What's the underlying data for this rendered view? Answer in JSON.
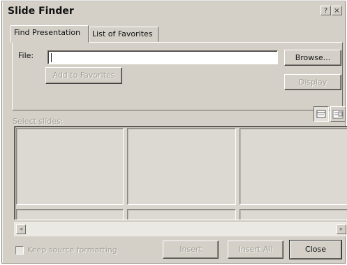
{
  "window": {
    "title": "Slide Finder",
    "help_glyph": "?",
    "close_glyph": "×"
  },
  "tabs": [
    {
      "label": "Find Presentation",
      "active": true
    },
    {
      "label": "List of Favorites",
      "active": false
    }
  ],
  "file": {
    "label": "File:",
    "value": "",
    "placeholder": ""
  },
  "buttons": {
    "browse": "Browse...",
    "add_to_favorites": "Add to Favorites",
    "display": "Display",
    "insert": "Insert",
    "insert_all": "Insert All",
    "close": "Close"
  },
  "select_slides_label": "Select slides:",
  "view_buttons": [
    "slide-view-icon",
    "title-list-view-icon"
  ],
  "keep_source_formatting": {
    "label": "Keep source formatting",
    "checked": false
  },
  "scroll": {
    "left_arrow": "◂",
    "right_arrow": "▸"
  },
  "colors": {
    "face": "#d4d0c8",
    "disabled_text": "#a5a29b"
  }
}
